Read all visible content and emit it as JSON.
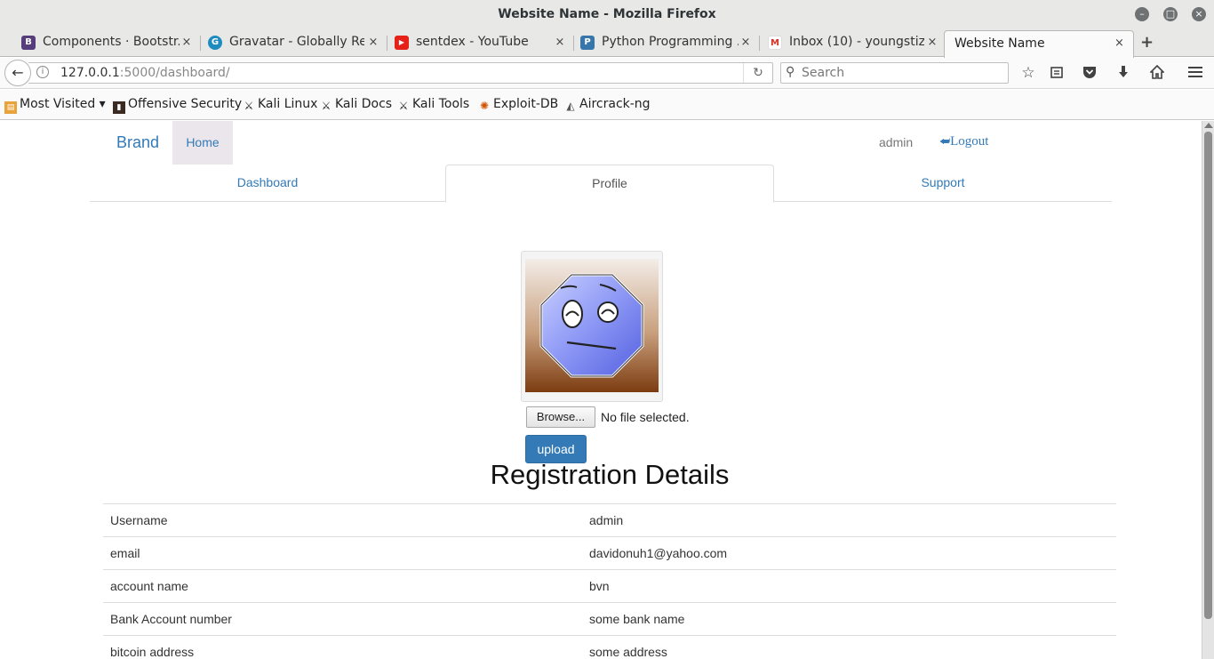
{
  "window": {
    "title": "Website Name - Mozilla Firefox",
    "controls": {
      "minimize": "–",
      "maximize": "□",
      "close": "×"
    }
  },
  "tabs": [
    {
      "label": "Components · Bootstr...",
      "favicon": "B",
      "favicon_color": "#563d7c"
    },
    {
      "label": "Gravatar - Globally Re...",
      "favicon": "G",
      "favicon_color": "#1e8cbe"
    },
    {
      "label": "sentdex - YouTube",
      "favicon": "▶",
      "favicon_color": "#e62117"
    },
    {
      "label": "Python Programming ...",
      "favicon": "P",
      "favicon_color": "#3776ab"
    },
    {
      "label": "Inbox (10) - youngstiz...",
      "favicon": "M",
      "favicon_color": "#d93025"
    },
    {
      "label": "Website Name",
      "favicon": "",
      "favicon_color": ""
    }
  ],
  "tab_close": "×",
  "new_tab": "+",
  "navbar": {
    "url_host": "127.0.0.1",
    "url_rest": ":5000/dashboard/",
    "search_placeholder": "Search",
    "icons": [
      "back-icon",
      "info-icon",
      "reload-icon",
      "search-icon",
      "star-icon",
      "reading-list-icon",
      "pocket-icon",
      "download-icon",
      "home-icon",
      "menu-icon"
    ]
  },
  "bookmarks": [
    {
      "label": "Most Visited ▾",
      "icon": "folder-icon"
    },
    {
      "label": "Offensive Security",
      "icon": "offsec-icon"
    },
    {
      "label": "Kali Linux",
      "icon": "kali-icon"
    },
    {
      "label": "Kali Docs",
      "icon": "kali-icon"
    },
    {
      "label": "Kali Tools",
      "icon": "kali-icon"
    },
    {
      "label": "Exploit-DB",
      "icon": "exploitdb-icon"
    },
    {
      "label": "Aircrack-ng",
      "icon": "aircrack-icon"
    }
  ],
  "site": {
    "brand": "Brand",
    "home": "Home",
    "user": "admin",
    "logout": "Logout",
    "accent": "#337ab7",
    "tabs": [
      {
        "label": "Dashboard",
        "active": false
      },
      {
        "label": "Profile",
        "active": true
      },
      {
        "label": "Support",
        "active": false
      }
    ],
    "file": {
      "browse": "Browse...",
      "status": "No file selected.",
      "upload": "upload"
    },
    "registration": {
      "title": "Registration Details",
      "rows": [
        {
          "key": "Username",
          "value": "admin"
        },
        {
          "key": "email",
          "value": "davidonuh1@yahoo.com"
        },
        {
          "key": "account name",
          "value": "bvn"
        },
        {
          "key": "Bank Account number",
          "value": "some bank name"
        },
        {
          "key": "bitcoin address",
          "value": "some address"
        }
      ]
    }
  }
}
